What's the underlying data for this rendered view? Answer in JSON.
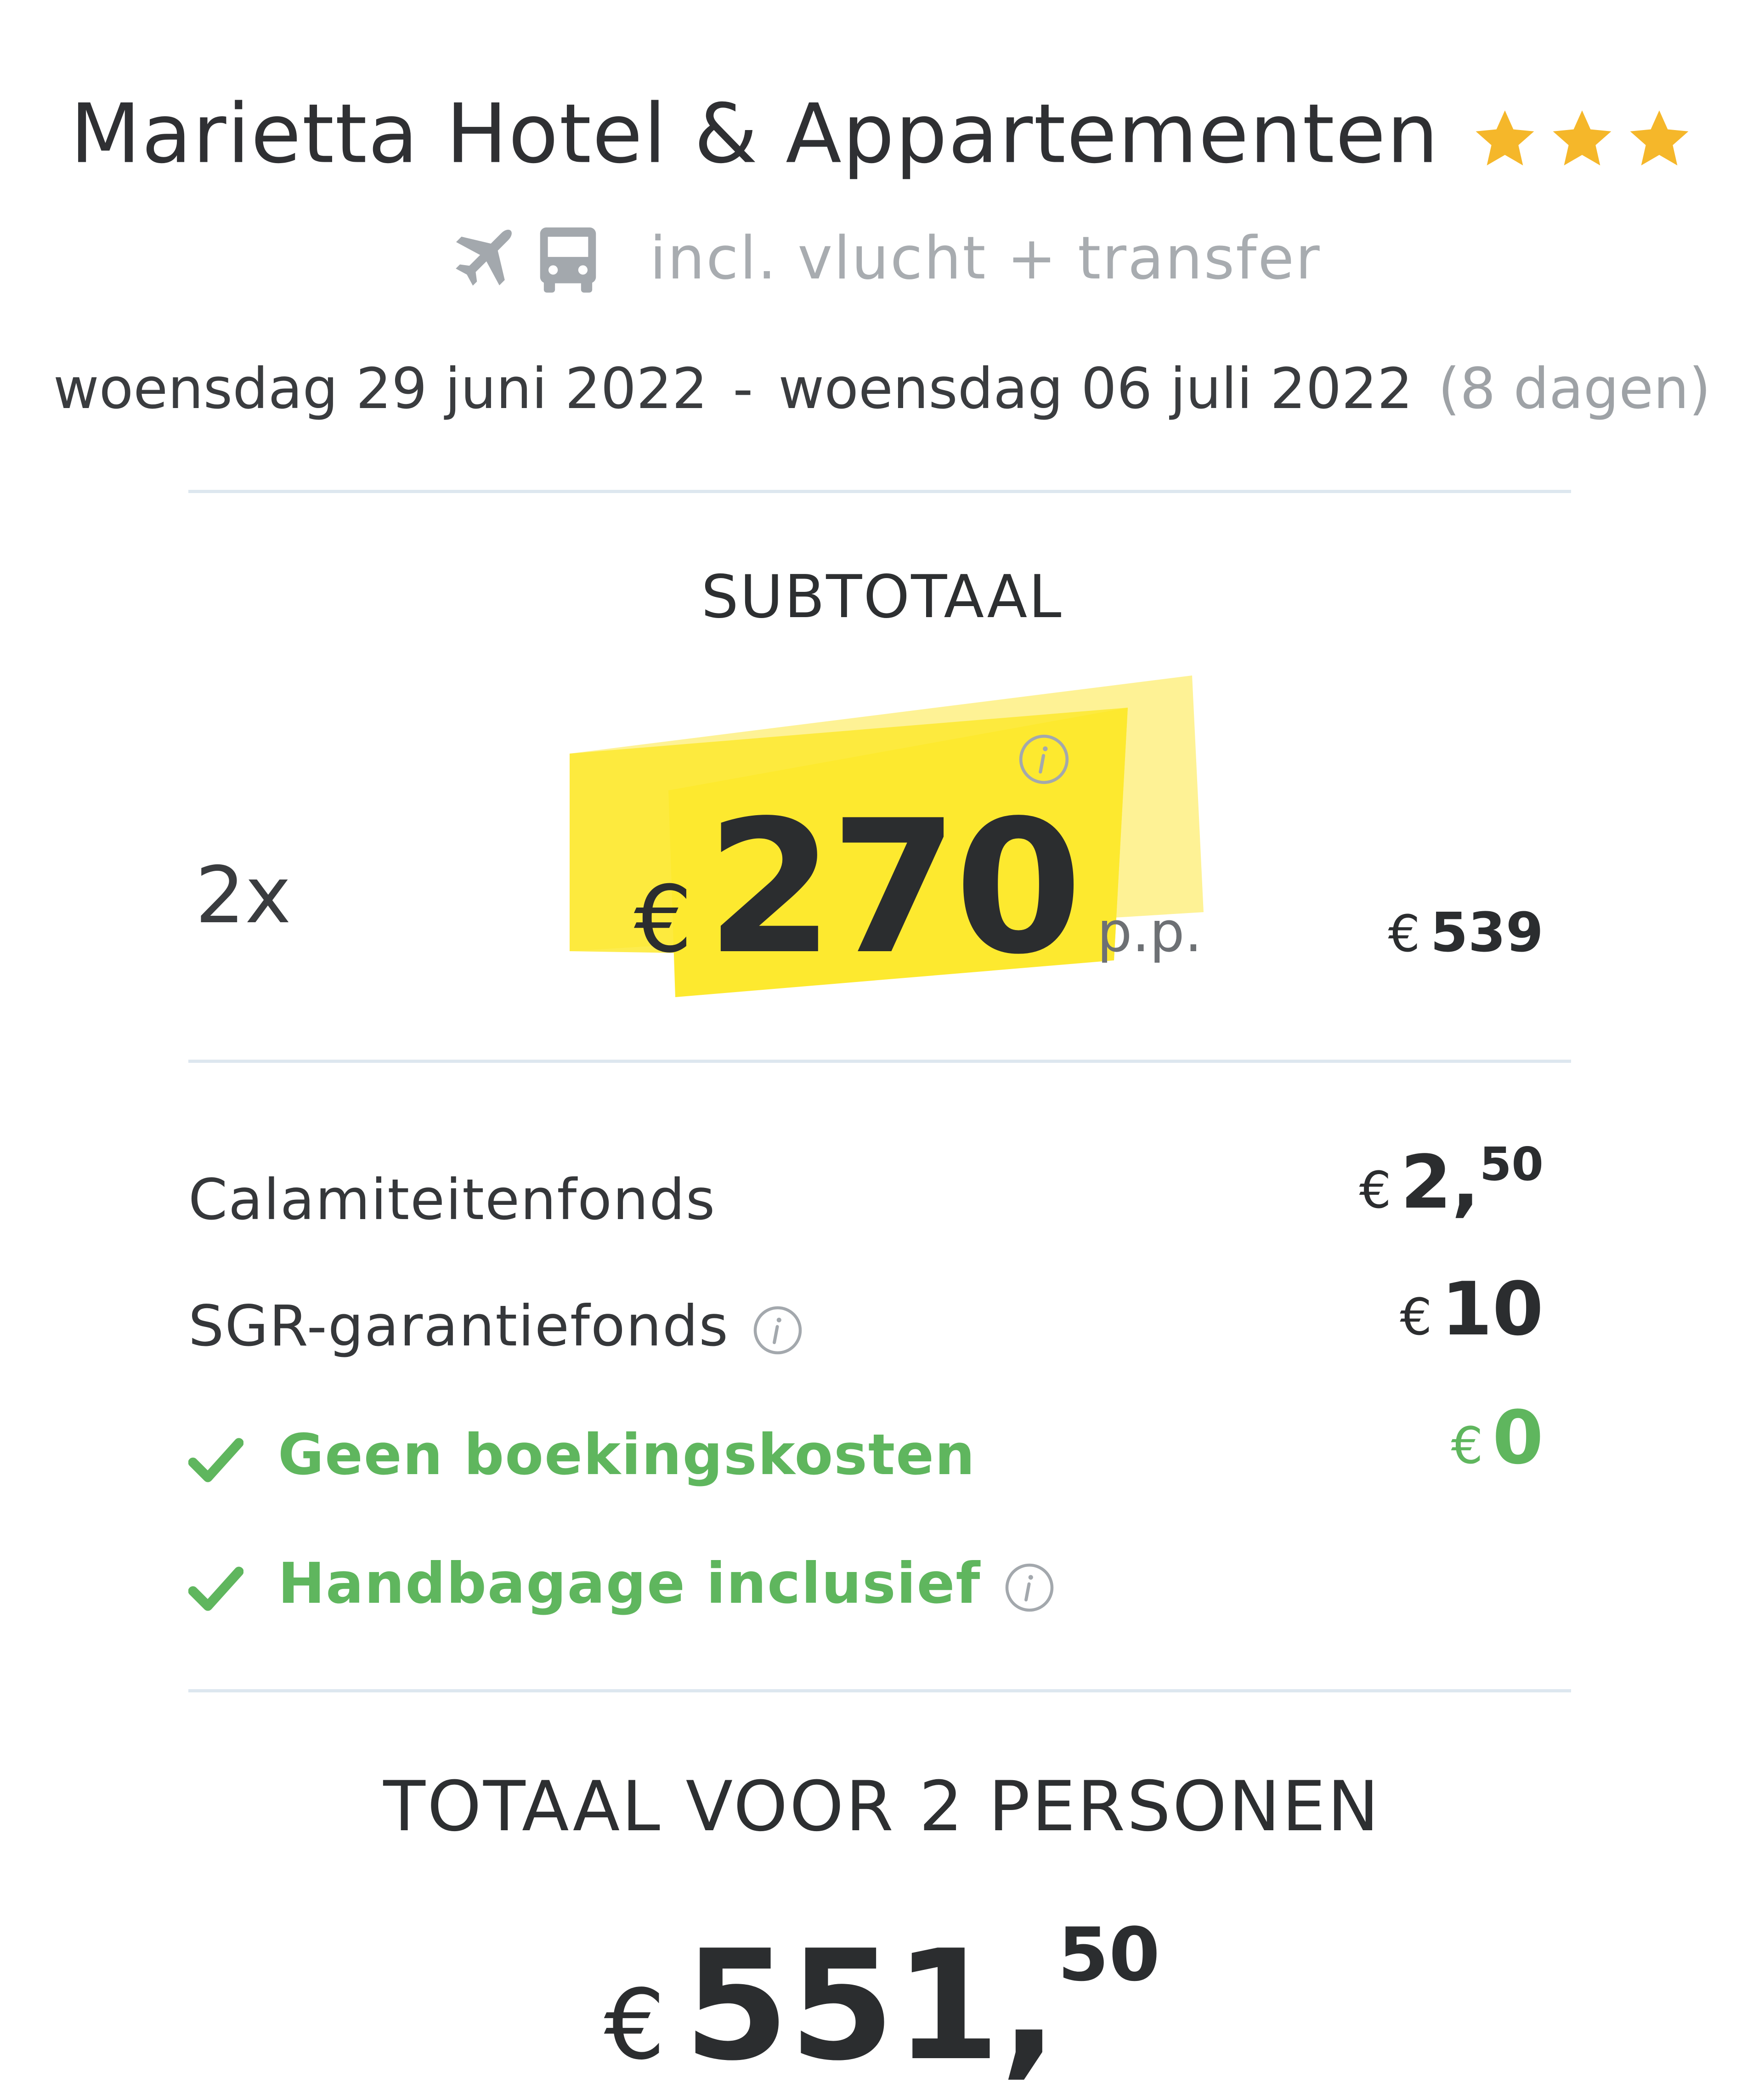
{
  "header": {
    "hotel_name": "Marietta Hotel & Appartementen",
    "star_rating": 3,
    "star_color": "#f5b72a",
    "transport_icons": [
      "plane-icon",
      "bus-icon"
    ],
    "transport_text": "incl. vlucht + transfer",
    "date_start": "woensdag 29 juni 2022",
    "date_separator": "-",
    "date_end": "woensdag 06 juli 2022",
    "duration": "(8 dagen)"
  },
  "subtotal": {
    "label": "SUBTOTAAL",
    "pax_count": "2x",
    "currency": "€",
    "price_per_person": "270",
    "per_person_unit": "p.p.",
    "subtotal_currency": "€",
    "subtotal_amount": "539",
    "highlight_color": "#fde92f"
  },
  "costs": [
    {
      "label": "Calamiteitenfonds",
      "currency": "€",
      "amount": "2,",
      "amount_sup": "50",
      "has_info": false,
      "included": false
    },
    {
      "label": "SGR-garantiefonds",
      "currency": "€",
      "amount": "10",
      "amount_sup": "",
      "has_info": true,
      "included": false
    },
    {
      "label": "Geen boekingskosten",
      "currency": "€",
      "amount": "0",
      "amount_sup": "",
      "has_info": false,
      "included": true
    },
    {
      "label": "Handbagage inclusief",
      "currency": "",
      "amount": "",
      "amount_sup": "",
      "has_info": true,
      "included": true
    }
  ],
  "total": {
    "label": "TOTAAL VOOR 2 PERSONEN",
    "currency": "€",
    "amount": "551,",
    "amount_sup": "50"
  },
  "colors": {
    "text": "#2b2d2f",
    "muted": "#a8acb0",
    "green": "#5fb65e",
    "divider": "#dde7ef"
  }
}
